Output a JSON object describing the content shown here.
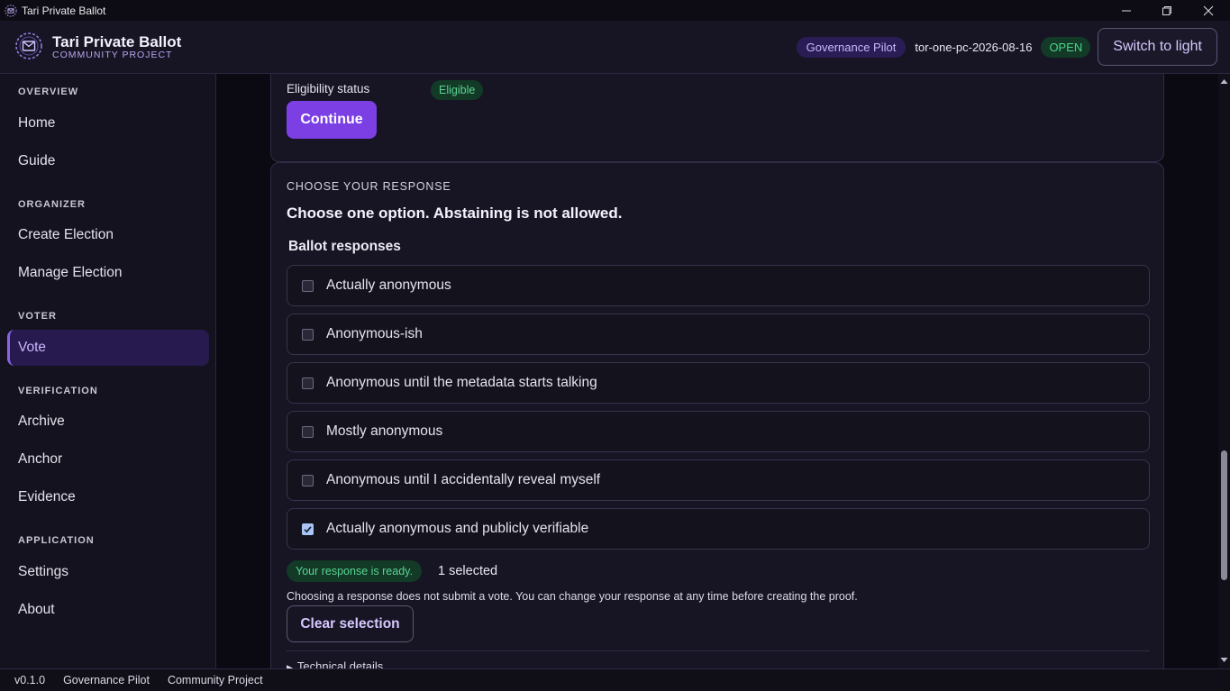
{
  "window": {
    "title": "Tari Private Ballot"
  },
  "header": {
    "brand_name": "Tari Private Ballot",
    "brand_sub": "COMMUNITY PROJECT",
    "profile_badge": "Governance Pilot",
    "election_id": "tor-one-pc-2026-08-16",
    "status_badge": "OPEN",
    "theme_button": "Switch to light"
  },
  "sidebar": {
    "groups": [
      {
        "label": "OVERVIEW",
        "items": [
          "Home",
          "Guide"
        ]
      },
      {
        "label": "ORGANIZER",
        "items": [
          "Create Election",
          "Manage Election"
        ]
      },
      {
        "label": "VOTER",
        "items": [
          "Vote"
        ]
      },
      {
        "label": "VERIFICATION",
        "items": [
          "Archive",
          "Anchor",
          "Evidence"
        ]
      },
      {
        "label": "APPLICATION",
        "items": [
          "Settings",
          "About"
        ]
      }
    ],
    "active_item": "Vote"
  },
  "eligibility": {
    "label": "Eligibility status",
    "badge": "Eligible",
    "continue_label": "Continue"
  },
  "response": {
    "section_label": "CHOOSE YOUR RESPONSE",
    "heading": "Choose one option. Abstaining is not allowed.",
    "list_title": "Ballot responses",
    "options": [
      {
        "label": "Actually anonymous",
        "checked": false
      },
      {
        "label": "Anonymous-ish",
        "checked": false
      },
      {
        "label": "Anonymous until the metadata starts talking",
        "checked": false
      },
      {
        "label": "Mostly anonymous",
        "checked": false
      },
      {
        "label": "Anonymous until I accidentally reveal myself",
        "checked": false
      },
      {
        "label": "Actually anonymous and publicly verifiable",
        "checked": true
      }
    ],
    "ready_badge": "Your response is ready.",
    "selected_count": "1 selected",
    "hint": "Choosing a response does not submit a vote. You can change your response at any time before creating the proof.",
    "clear_label": "Clear selection",
    "technical_details": "Technical details"
  },
  "footer": {
    "version": "v0.1.0",
    "profile": "Governance Pilot",
    "project": "Community Project"
  },
  "colors": {
    "accent": "#7b3fe4",
    "active_nav_bg": "#271a4f",
    "success_bg": "#123a26",
    "success_text": "#5bd494"
  }
}
